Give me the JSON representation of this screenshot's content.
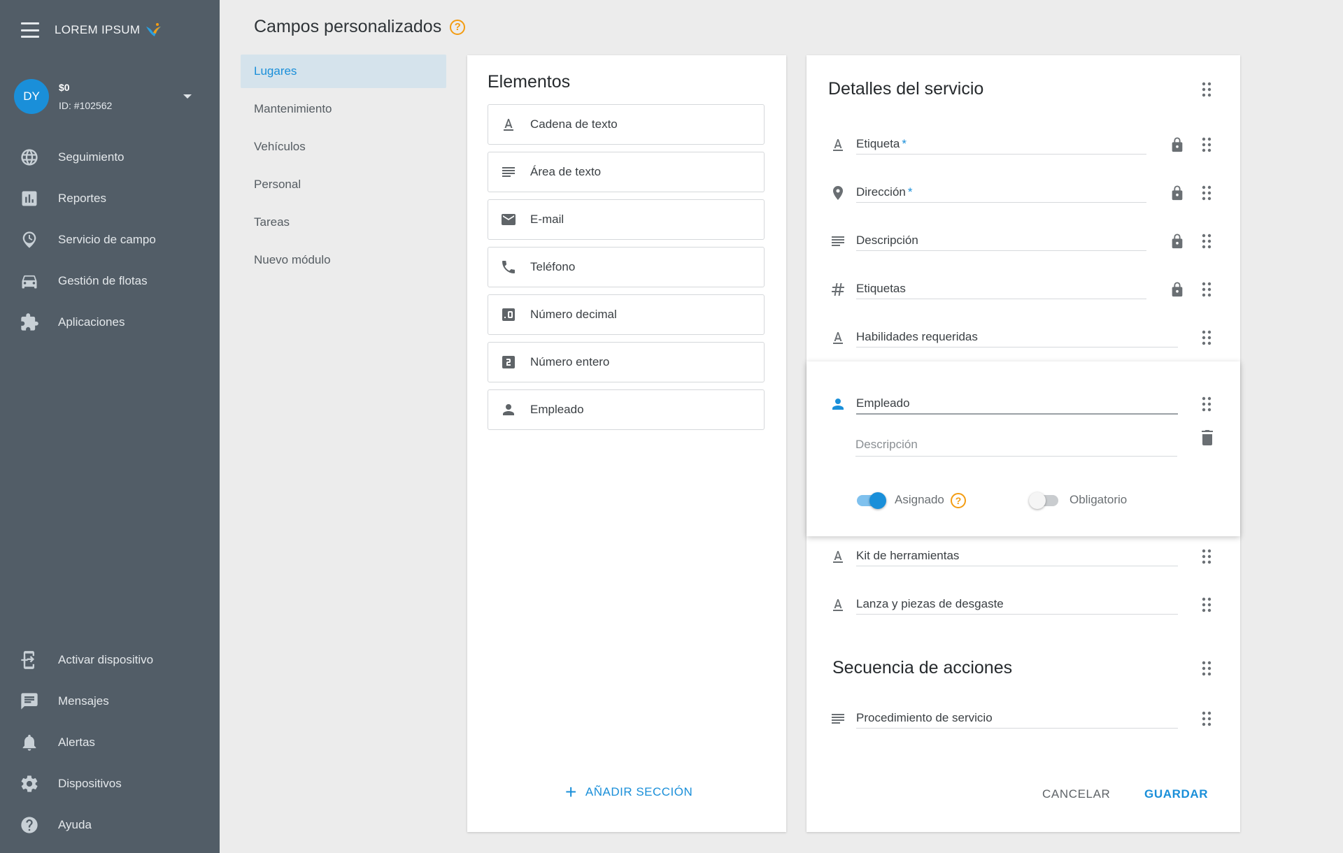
{
  "sidebar": {
    "brand": "LOREM IPSUM",
    "account": {
      "initials": "DY",
      "balance": "$0",
      "id": "ID: #102562"
    },
    "nav_top": [
      {
        "label": "Seguimiento",
        "icon": "globe-icon"
      },
      {
        "label": "Reportes",
        "icon": "bar-chart-icon"
      },
      {
        "label": "Servicio de campo",
        "icon": "location-clock-icon"
      },
      {
        "label": "Gestión de flotas",
        "icon": "car-icon"
      },
      {
        "label": "Aplicaciones",
        "icon": "puzzle-icon"
      }
    ],
    "nav_bottom": [
      {
        "label": "Activar dispositivo",
        "icon": "add-device-icon"
      },
      {
        "label": "Mensajes",
        "icon": "message-icon"
      },
      {
        "label": "Alertas",
        "icon": "bell-icon"
      },
      {
        "label": "Dispositivos",
        "icon": "gear-icon"
      },
      {
        "label": "Ayuda",
        "icon": "help-icon"
      }
    ]
  },
  "header": {
    "title": "Campos personalizados",
    "help": "?"
  },
  "modules": [
    "Lugares",
    "Mantenimiento",
    "Vehículos",
    "Personal",
    "Tareas",
    "Nuevo módulo"
  ],
  "elements": {
    "title": "Elementos",
    "items": [
      {
        "label": "Cadena de texto",
        "icon": "text-icon"
      },
      {
        "label": "Área de texto",
        "icon": "textarea-icon"
      },
      {
        "label": "E-mail",
        "icon": "email-icon"
      },
      {
        "label": "Teléfono",
        "icon": "phone-icon"
      },
      {
        "label": "Número decimal",
        "icon": "decimal-icon"
      },
      {
        "label": "Número entero",
        "icon": "integer-icon"
      },
      {
        "label": "Empleado",
        "icon": "person-icon"
      }
    ],
    "add_section": "AÑADIR SECCIÓN"
  },
  "details": {
    "section1_title": "Detalles del servicio",
    "fields": [
      {
        "label": "Etiqueta",
        "required": "*",
        "icon": "text-icon",
        "locked": true
      },
      {
        "label": "Dirección",
        "required": "*",
        "icon": "location-pin-icon",
        "locked": true
      },
      {
        "label": "Descripción",
        "required": "",
        "icon": "textarea-icon",
        "locked": true
      },
      {
        "label": "Etiquetas",
        "required": "",
        "icon": "hashtag-icon",
        "locked": true
      },
      {
        "label": "Habilidades requeridas",
        "required": "",
        "icon": "text-icon",
        "locked": false
      }
    ],
    "expanded": {
      "label": "Empleado",
      "description_placeholder": "Descripción",
      "assigned_label": "Asignado",
      "assigned_on": true,
      "required_label": "Obligatorio",
      "required_on": false,
      "help": "?"
    },
    "fields_after": [
      {
        "label": "Kit de herramientas",
        "icon": "text-icon"
      },
      {
        "label": "Lanza y piezas de desgaste",
        "icon": "text-icon"
      }
    ],
    "section2_title": "Secuencia de acciones",
    "section2_fields": [
      {
        "label": "Procedimiento de servicio",
        "icon": "textarea-icon"
      }
    ],
    "cancel": "CANCELAR",
    "save": "GUARDAR"
  },
  "colors": {
    "accent": "#1a8fd9",
    "sidebar": "#525d67",
    "help": "#f39c12"
  }
}
